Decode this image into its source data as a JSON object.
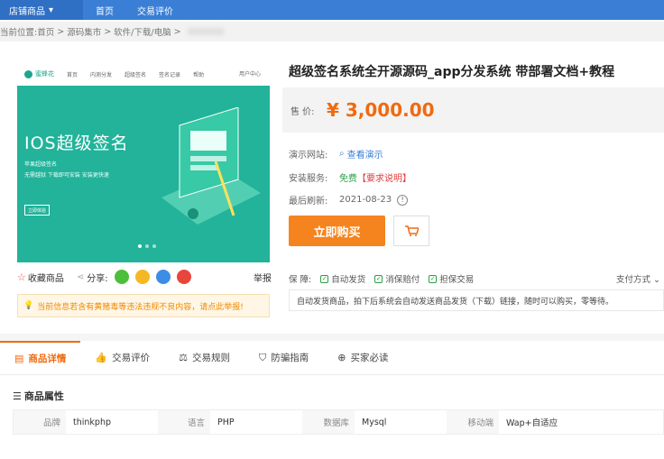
{
  "top_nav": {
    "shop_label": "店铺商品",
    "items": [
      "首页",
      "交易评价"
    ]
  },
  "breadcrumb": {
    "prefix": "当前位置:",
    "items": [
      "首页",
      "源码集市",
      "软件/下载/电脑"
    ]
  },
  "gallery": {
    "site_logo": "蜜蜂花",
    "site_nav": [
      "首页",
      "内测分发",
      "超级签名",
      "签名记录",
      "帮助"
    ],
    "account": "用户中心",
    "headline": "IOS超级签名",
    "sub1": "苹果超级签名",
    "sub2": "无需越狱 下载即可安装 安装更快速",
    "cta": "立即体验"
  },
  "product": {
    "title": "超级签名系统全开源源码_app分发系统 带部署文档+教程",
    "price_label": "售 价:",
    "price": "¥ 3,000.00",
    "demo_label": "演示网站:",
    "demo_link": "查看演示",
    "service_label": "安装服务:",
    "service_value": "免费",
    "service_req": "【要求说明】",
    "refresh_label": "最后刷新:",
    "refresh_date": "2021-08-23",
    "buy_label": "立即购买"
  },
  "share": {
    "fav_label": "收藏商品",
    "share_label": "分享:",
    "report_label": "举报"
  },
  "warning": "当前信息若含有黄赌毒等违法违规不良内容，请点此举报!",
  "guarantee": {
    "label": "保 障:",
    "items": [
      "自动发货",
      "消保赔付",
      "担保交易"
    ],
    "pay_label": "支付方式"
  },
  "notice": "自动发货商品，拍下后系统会自动发送商品发货（下载）链接，随时可以购买，零等待。",
  "tabs": [
    "商品详情",
    "交易评价",
    "交易规则",
    "防骗指南",
    "买家必读"
  ],
  "attributes_title": "商品属性",
  "attributes": [
    {
      "k": "品牌",
      "v": "thinkphp"
    },
    {
      "k": "语言",
      "v": "PHP"
    },
    {
      "k": "数据库",
      "v": "Mysql"
    },
    {
      "k": "移动端",
      "v": "Wap+自适应"
    }
  ],
  "colors": {
    "accent": "#f06a10",
    "nav": "#3a7fd5",
    "hero": "#22b39a"
  }
}
